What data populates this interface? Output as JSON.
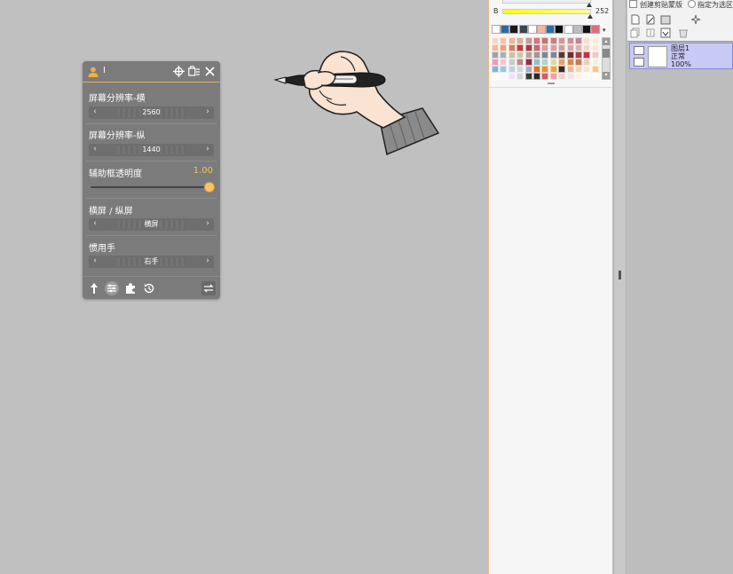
{
  "panel": {
    "user_name": "I",
    "settings": [
      {
        "label": "屏幕分辨率-横",
        "value": "2560"
      },
      {
        "label": "屏幕分辨率-纵",
        "value": "1440"
      }
    ],
    "opacity": {
      "label": "辅助框透明度",
      "value": "1.00",
      "fraction": 1.0
    },
    "orientation": {
      "label": "横屏 / 纵屏",
      "value": "横屏"
    },
    "hand": {
      "label": "惯用手",
      "value": "右手"
    },
    "arrow_left": "‹",
    "arrow_right": "›",
    "icons": [
      "user-icon",
      "crosshair-icon",
      "window-list-icon",
      "close-icon",
      "pointer-icon",
      "sliders-icon",
      "puzzle-icon",
      "history-icon",
      "swap-icon"
    ]
  },
  "color_panel": {
    "brightness_label": "B",
    "brightness_value": "252",
    "brightness_fraction": 0.99,
    "dropdown_arrow": "▾",
    "scroll_up": "▴",
    "scroll_down": "▾",
    "history_colors": [
      "#ffffff",
      "#2d6aa3",
      "#1a1a1a",
      "#3c4652",
      "#ffffff",
      "#f0b7a4",
      "#2a6fa8",
      "#0d0d0d",
      "#ffffff",
      "#bdbdbd",
      "#111111",
      "#e46a7a"
    ],
    "palette": [
      [
        "#f6d7c4",
        "#f5c3a8",
        "#f0b59a",
        "#dcaf9a",
        "#c49a93",
        "#c97a7a",
        "#c7706e",
        "#c87d83",
        "#d29796",
        "#cf9096",
        "#c58392",
        "#f7e2c7",
        "#f9edd8"
      ],
      [
        "#f1b99d",
        "#eea07d",
        "#d07e66",
        "#be3f3a",
        "#a73b3b",
        "#c76671",
        "#d79e9c",
        "#d4a1a4",
        "#c8a3a2",
        "#d2a6aa",
        "#d8b5b0",
        "#efd8c5",
        "#f6e8d4"
      ],
      [
        "#9ea4a9",
        "#a9b0b6",
        "#c7c3a6",
        "#d2c6a4",
        "#b8a497",
        "#a69690",
        "#7c8890",
        "#7d8a93",
        "#5a3a2a",
        "#6b2d2d",
        "#a04242",
        "#c82c4c",
        "#f0c8c8"
      ],
      [
        "#e9a0b1",
        "#f1c7d0",
        "#c9cad3",
        "#b48a8a",
        "#8f2c4c",
        "#8ec3c6",
        "#b3d4c8",
        "#e0d6a3",
        "#e3a36a",
        "#d48a4f",
        "#c97a4c",
        "#e8d3b5",
        "#f5efe2"
      ],
      [
        "#8fb0d0",
        "#9ec6e0",
        "#c7cfd7",
        "#d0d7de",
        "#a8aeb5",
        "#e46c2c",
        "#e98f3a",
        "#f29f48",
        "#3a2a25",
        "#ecb89a",
        "#f6d4b6",
        "#f8e6cf",
        "#f3c78f"
      ],
      [
        "#ffffff",
        "#f8f8f8",
        "#f0e0ff",
        "#d8d8d8",
        "#3b3b3b",
        "#292929",
        "#d85c5c",
        "#e7a4a4",
        "#f2d0d0",
        "#f7e4e4",
        "#fff1e6",
        "#fff8f0",
        "#ffffff"
      ]
    ]
  },
  "layers_panel": {
    "clip_label": "创建剪贴蒙版",
    "select_label": "指定为选区",
    "icons": [
      "new-layer-icon",
      "new-vector-icon",
      "new-folder-icon",
      "layer-effect-icon",
      "copy-layer-icon",
      "merge-icon",
      "merge-down-icon",
      "delete-icon"
    ],
    "layer": {
      "name": "图层1",
      "mode": "正常",
      "opacity": "100%"
    }
  }
}
